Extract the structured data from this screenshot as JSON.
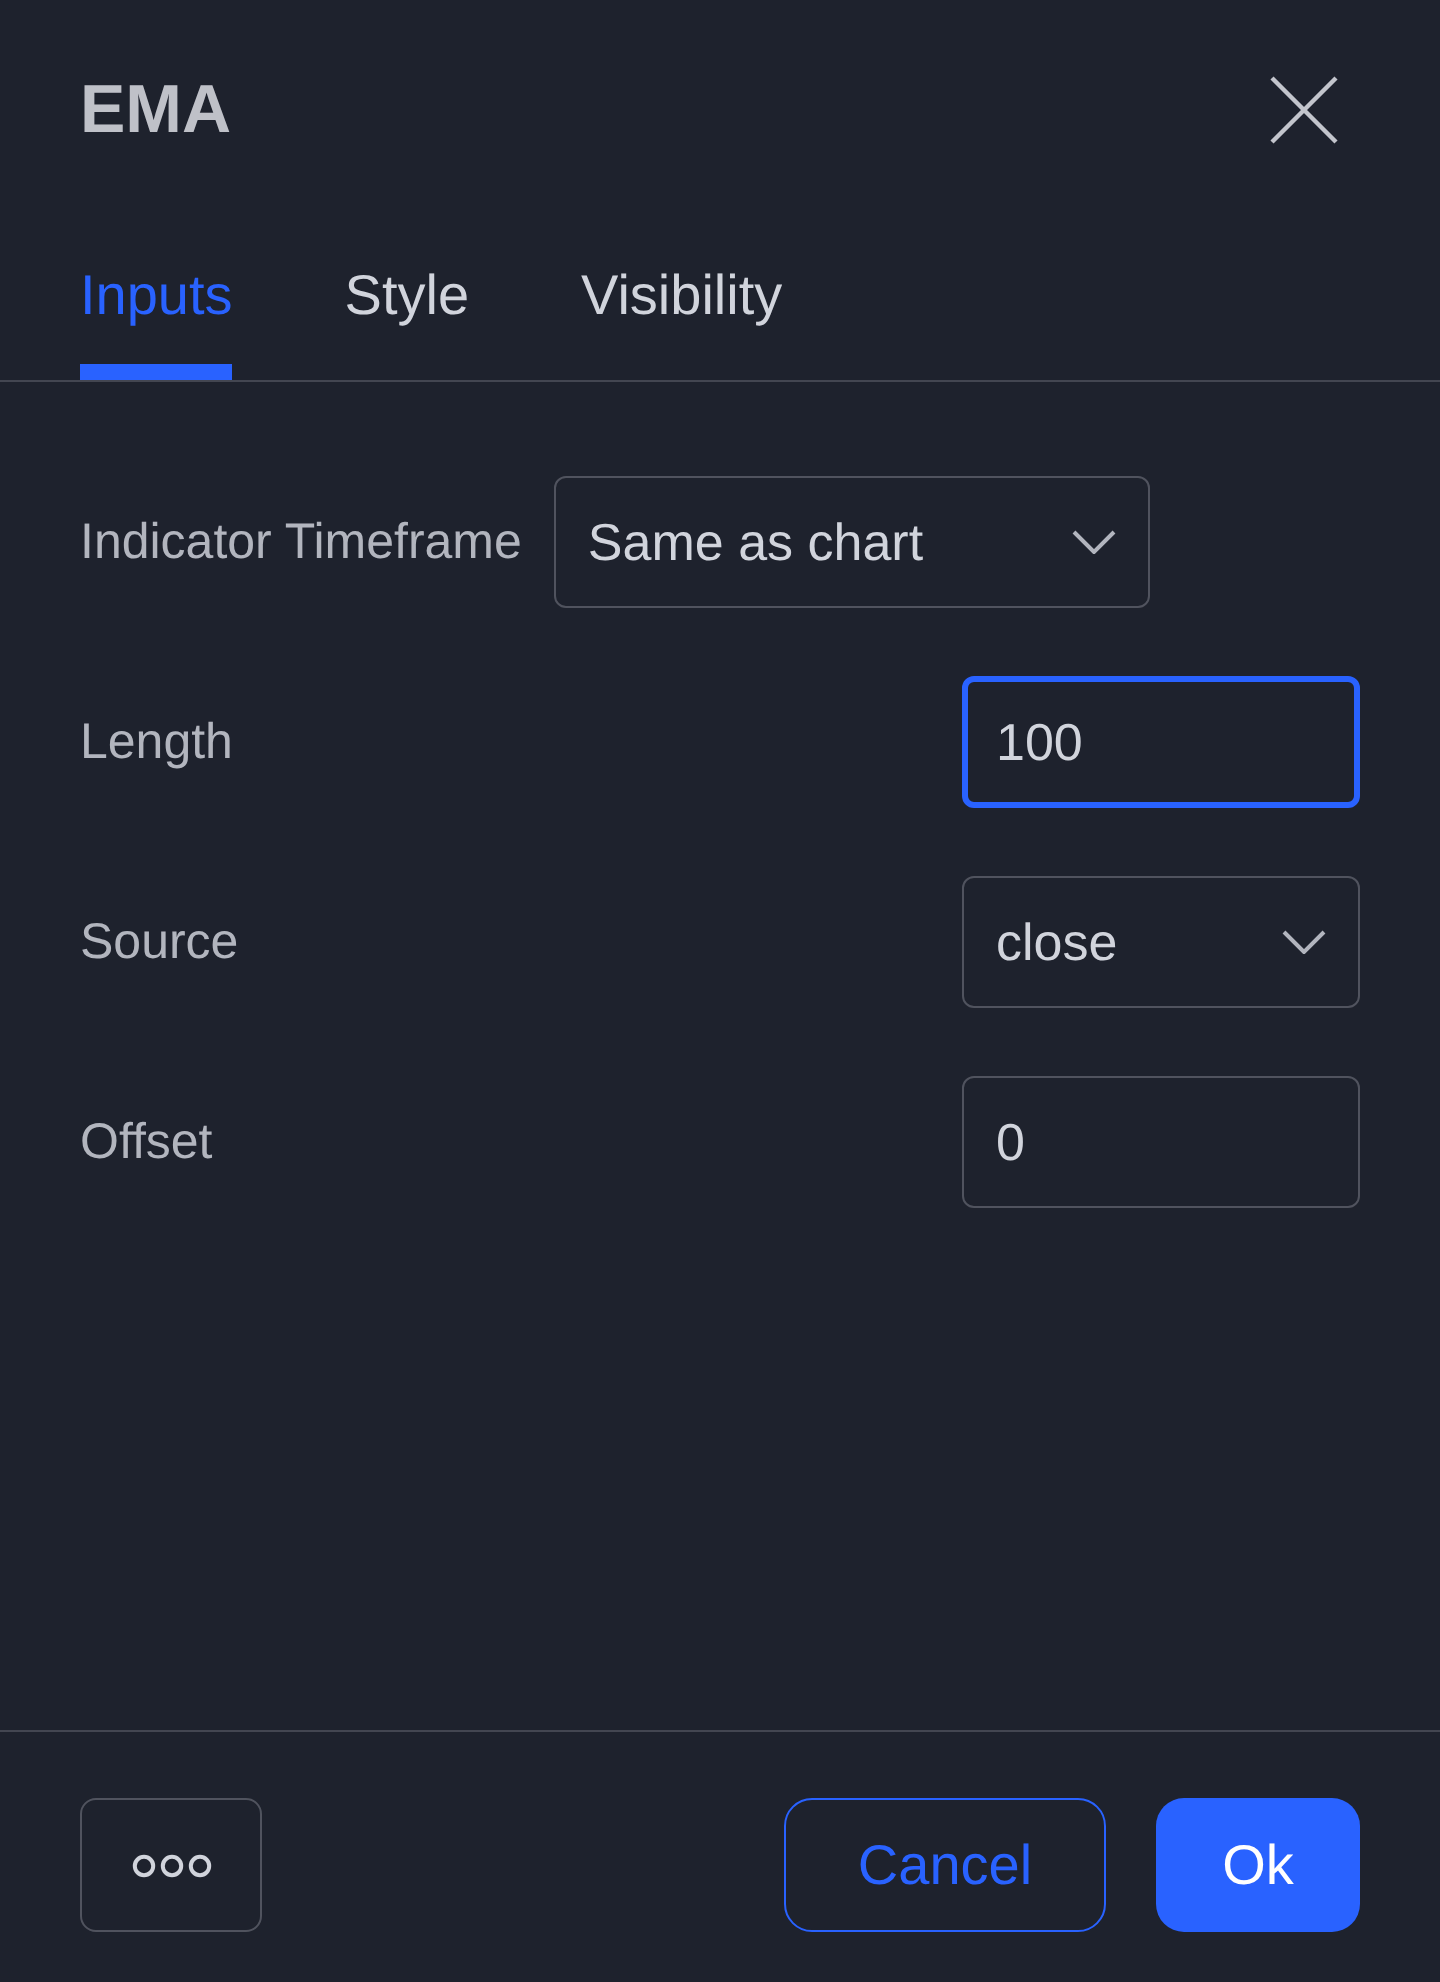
{
  "dialog": {
    "title": "EMA"
  },
  "tabs": [
    {
      "label": "Inputs",
      "selected": true
    },
    {
      "label": "Style",
      "selected": false
    },
    {
      "label": "Visibility",
      "selected": false
    }
  ],
  "timeframe": {
    "label": "Indicator Timeframe",
    "value": "Same as chart"
  },
  "inputs": [
    {
      "kind": "number",
      "label": "Length",
      "value": "100",
      "focused": true
    },
    {
      "kind": "select",
      "label": "Source",
      "value": "close",
      "focused": false
    },
    {
      "kind": "number",
      "label": "Offset",
      "value": "0",
      "focused": false
    }
  ],
  "footer": {
    "buttons": [
      {
        "kind": "more"
      },
      {
        "kind": "secondary",
        "label": "Cancel"
      },
      {
        "kind": "primary",
        "label": "Ok"
      }
    ]
  }
}
